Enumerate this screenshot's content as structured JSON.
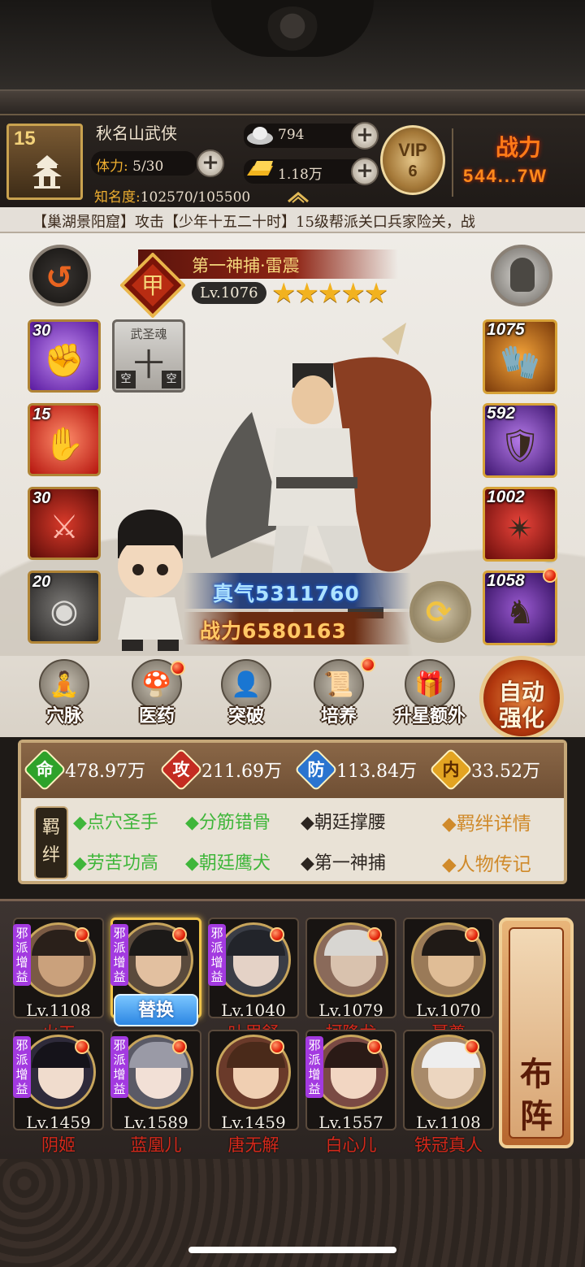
{
  "player": {
    "level": "15",
    "name": "秋名山武侠",
    "stamina_label": "体力:",
    "stamina_value": "5/30",
    "fame_label": "知名度:",
    "fame_value": "102570/105500"
  },
  "currency": {
    "silver": "794",
    "gold": "1.18万"
  },
  "vip": {
    "label": "VIP",
    "level": "6"
  },
  "power_top": {
    "label": "战力",
    "value": "544...7W"
  },
  "marquee": "【巢湖景阳窟】攻击【少年十五二十时】15级帮派关口兵家险关，战",
  "hero": {
    "title": "第一神捕·雷震",
    "level": "Lv.1076",
    "stars": 5,
    "stars_text": "★★★★★",
    "zhenqi": "真气5311760",
    "zhanli": "战力6580163"
  },
  "skills": [
    {
      "level": "30",
      "icon": "purple-fist-icon"
    },
    {
      "level": "15",
      "icon": "red-palm-icon"
    },
    {
      "level": "30",
      "icon": "acupoint-icon"
    },
    {
      "level": "20",
      "icon": "gray-medallion-icon"
    }
  ],
  "soul": {
    "title": "武圣魂",
    "char": "十",
    "empty": "空"
  },
  "equipment": [
    {
      "level": "1075",
      "icon": "gauntlet-icon",
      "upgrade": true
    },
    {
      "level": "592",
      "icon": "armor-icon",
      "upgrade": true
    },
    {
      "level": "1002",
      "icon": "token-icon",
      "upgrade": false
    },
    {
      "level": "1058",
      "icon": "mount-icon",
      "upgrade": false,
      "red_dot": true
    }
  ],
  "functions": [
    {
      "label": "穴脉",
      "icon": "meridian-icon"
    },
    {
      "label": "医药",
      "icon": "medicine-icon"
    },
    {
      "label": "突破",
      "icon": "breakthrough-icon"
    },
    {
      "label": "培养",
      "icon": "train-icon"
    },
    {
      "label": "升星额外",
      "icon": "star-up-icon"
    }
  ],
  "auto_strengthen": {
    "line1": "自动",
    "line2": "强化"
  },
  "stats": [
    {
      "key": "命",
      "value": "478.97万",
      "color": "#2ea22a"
    },
    {
      "key": "攻",
      "value": "211.69万",
      "color": "#c42c22"
    },
    {
      "key": "防",
      "value": "113.84万",
      "color": "#2a74cf"
    },
    {
      "key": "内",
      "value": "33.52万",
      "color": "#e3a422"
    }
  ],
  "bonds": {
    "tag": "羁绊",
    "row1": [
      {
        "text": "◆点穴圣手",
        "active": true
      },
      {
        "text": "◆分筋错骨",
        "active": true
      },
      {
        "text": "◆朝廷撑腰",
        "active": false
      }
    ],
    "row2": [
      {
        "text": "◆劳苦功高",
        "active": true
      },
      {
        "text": "◆朝廷鹰犬",
        "active": true
      },
      {
        "text": "◆第一神捕",
        "active": false
      }
    ],
    "detail_link": "◆羁绊详情",
    "bio_link": "◆人物传记"
  },
  "roster": {
    "tag": "邪派增益",
    "swap_label": "替换",
    "members": [
      {
        "level": "Lv.1108",
        "name": "火工",
        "tag": true
      },
      {
        "level": "",
        "name": "",
        "tag": true,
        "selected": true
      },
      {
        "level": "Lv.1040",
        "name": "叶眉舒",
        "tag": true
      },
      {
        "level": "Lv.1079",
        "name": "柯降龙",
        "tag": false
      },
      {
        "level": "Lv.1070",
        "name": "聂尊",
        "tag": false
      },
      {
        "level": "Lv.1459",
        "name": "阴姬",
        "tag": true
      },
      {
        "level": "Lv.1589",
        "name": "蓝凰儿",
        "tag": true
      },
      {
        "level": "Lv.1459",
        "name": "唐无解",
        "tag": false
      },
      {
        "level": "Lv.1557",
        "name": "白心儿",
        "tag": true
      },
      {
        "level": "Lv.1108",
        "name": "铁冠真人",
        "tag": false
      }
    ],
    "formation": {
      "line1": "布",
      "line2": "阵"
    }
  }
}
